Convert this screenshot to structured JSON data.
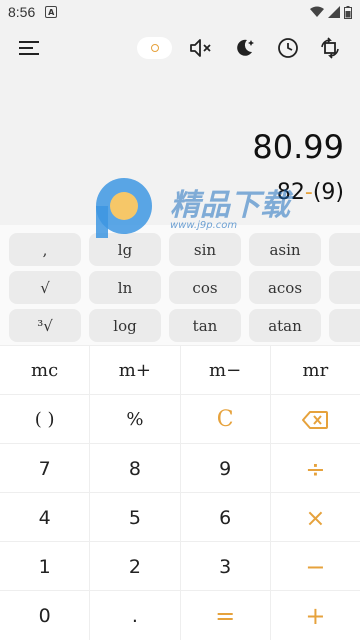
{
  "status": {
    "time": "8:56",
    "notif": "A"
  },
  "display": {
    "result": "80.99",
    "expr_left": "82",
    "expr_op": "-",
    "expr_right": "(9)"
  },
  "watermark": {
    "brand": "精品下载",
    "url": "www.j9p.com"
  },
  "sci_keys": [
    [
      ",",
      "lg",
      "sin",
      "asin"
    ],
    [
      "√",
      "ln",
      "cos",
      "acos"
    ],
    [
      "³√",
      "log",
      "tan",
      "atan"
    ]
  ],
  "pad": {
    "mem": [
      "mc",
      "m+",
      "m−",
      "mr"
    ],
    "r1": [
      "( )",
      "%",
      "C"
    ],
    "r2": [
      "7",
      "8",
      "9",
      "÷"
    ],
    "r3": [
      "4",
      "5",
      "6",
      "×"
    ],
    "r4": [
      "1",
      "2",
      "3",
      "−"
    ],
    "r5": [
      "0",
      ".",
      "=",
      "+"
    ]
  },
  "colors": {
    "accent": "#e6a23c"
  },
  "icons": [
    "menu-icon",
    "sound-off-icon",
    "night-mode-icon",
    "history-clock-icon",
    "rotate-icon",
    "backspace-icon"
  ]
}
